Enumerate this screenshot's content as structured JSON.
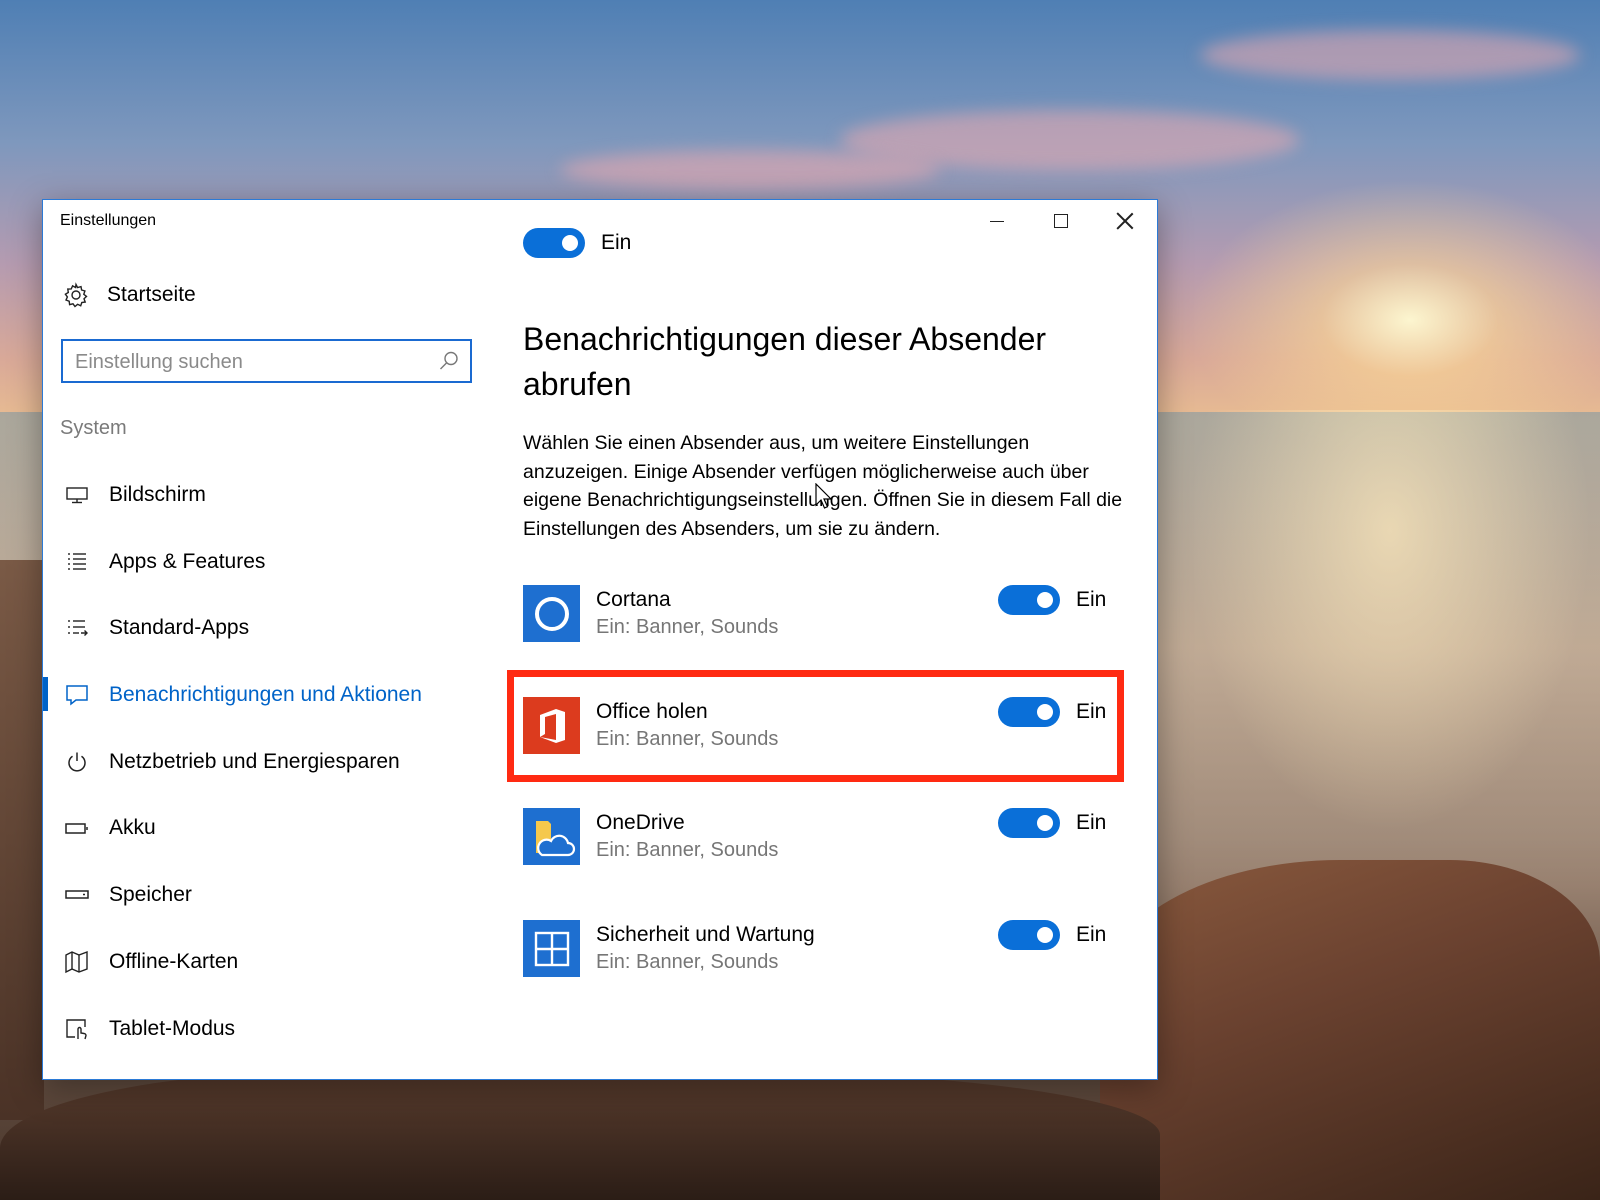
{
  "window": {
    "title": "Einstellungen",
    "controls": {
      "minimize": "minimize",
      "maximize": "maximize",
      "close": "close"
    }
  },
  "sidebar": {
    "home_label": "Startseite",
    "search": {
      "placeholder": "Einstellung suchen",
      "value": ""
    },
    "section_label": "System",
    "items": [
      {
        "label": "Bildschirm",
        "icon": "monitor-icon",
        "active": false
      },
      {
        "label": "Apps & Features",
        "icon": "list-icon",
        "active": false
      },
      {
        "label": "Standard-Apps",
        "icon": "default-apps-icon",
        "active": false
      },
      {
        "label": "Benachrichtigungen und Aktionen",
        "icon": "notification-icon",
        "active": true
      },
      {
        "label": "Netzbetrieb und Energiesparen",
        "icon": "power-icon",
        "active": false
      },
      {
        "label": "Akku",
        "icon": "battery-icon",
        "active": false
      },
      {
        "label": "Speicher",
        "icon": "storage-icon",
        "active": false
      },
      {
        "label": "Offline-Karten",
        "icon": "map-icon",
        "active": false
      },
      {
        "label": "Tablet-Modus",
        "icon": "tablet-icon",
        "active": false
      }
    ]
  },
  "main": {
    "top_toggle_label": "Ein",
    "heading": "Benachrichtigungen dieser Absender abrufen",
    "description": "Wählen Sie einen Absender aus, um weitere Einstellungen anzuzeigen. Einige Absender verfügen möglicherweise auch über eigene Benachrichtigungseinstellungen. Öffnen Sie in diesem Fall die Einstellungen des Absenders, um sie zu ändern.",
    "senders": [
      {
        "name": "Cortana",
        "sub": "Ein: Banner, Sounds",
        "toggle_label": "Ein",
        "on": true,
        "icon": "cortana-icon",
        "color": "#1e6fd0"
      },
      {
        "name": "Office holen",
        "sub": "Ein: Banner, Sounds",
        "toggle_label": "Ein",
        "on": true,
        "icon": "office-icon",
        "color": "#dc3b1e"
      },
      {
        "name": "OneDrive",
        "sub": "Ein: Banner, Sounds",
        "toggle_label": "Ein",
        "on": true,
        "icon": "onedrive-icon",
        "color": "#1e6fd0"
      },
      {
        "name": "Sicherheit und Wartung",
        "sub": "Ein: Banner, Sounds",
        "toggle_label": "Ein",
        "on": true,
        "icon": "security-maintenance-icon",
        "color": "#1e6fd0"
      }
    ]
  },
  "colors": {
    "accent": "#0063c8",
    "toggle_on": "#0a6fd8",
    "highlight": "#ff2a12"
  }
}
